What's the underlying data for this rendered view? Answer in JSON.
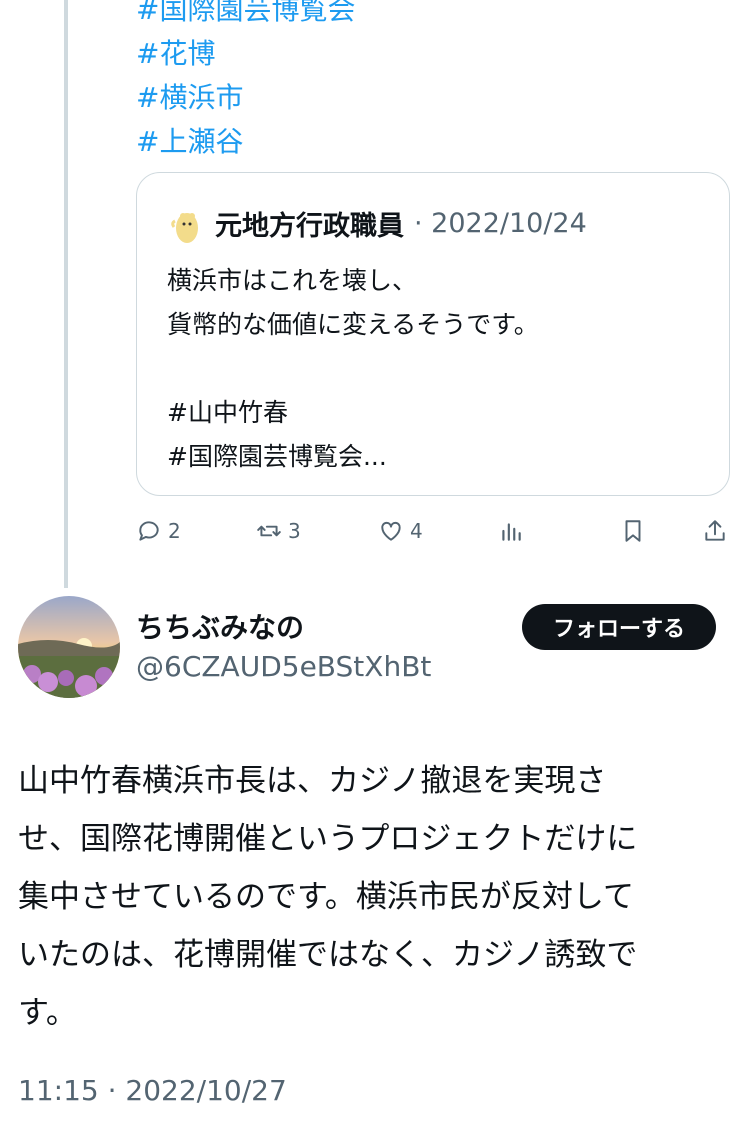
{
  "prev_tweet": {
    "hashtags": [
      "#国際園芸博覧会",
      "#花博",
      "#横浜市",
      "#上瀬谷"
    ],
    "quote": {
      "author_name": "元地方行政職員",
      "date": "2022/10/24",
      "lines": [
        "横浜市はこれを壊し、",
        "貨幣的な価値に変えるそうです。",
        "",
        "#山中竹春",
        "#国際園芸博覧会..."
      ]
    },
    "actions": {
      "replies": "2",
      "retweets": "3",
      "likes": "4"
    }
  },
  "tweet": {
    "author_name": "ちちぶみなの",
    "handle": "@6CZAUD5eBStXhBt",
    "follow_label": "フォローする",
    "text_lines": [
      "山中竹春横浜市長は、カジノ撤退を実現さ",
      "せ、国際花博開催というプロジェクトだけに",
      "集中させているのです。横浜市民が反対して",
      "いたのは、花博開催ではなく、カジノ誘致で",
      "す。"
    ],
    "timestamp": "11:15 · 2022/10/27"
  },
  "icons": [
    "reply-icon",
    "retweet-icon",
    "like-icon",
    "analytics-icon",
    "bookmark-icon",
    "share-icon"
  ]
}
